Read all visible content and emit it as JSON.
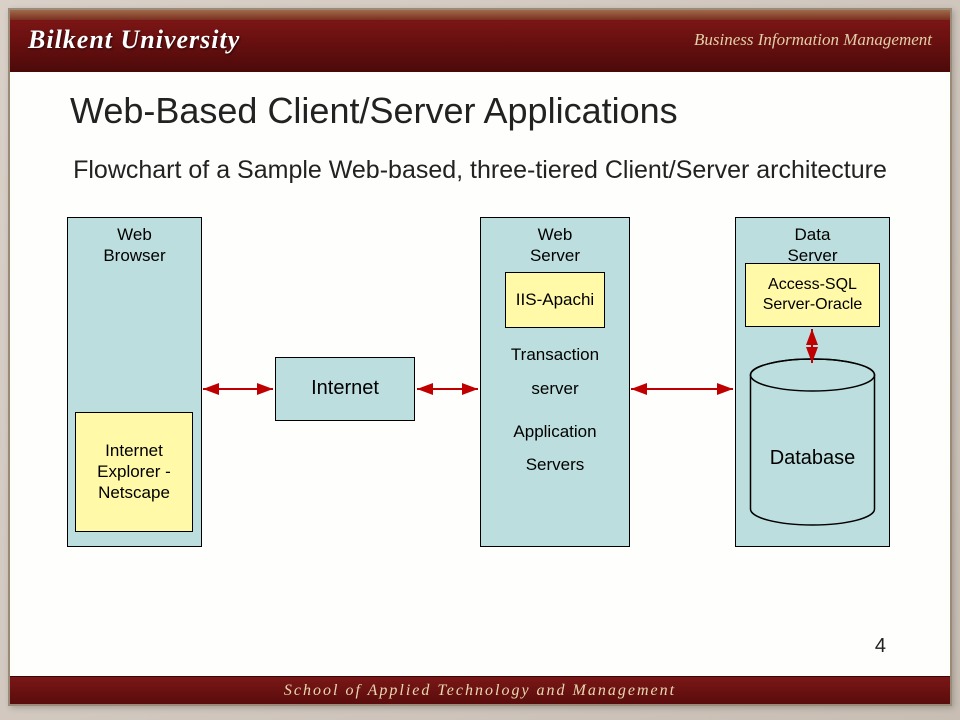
{
  "header": {
    "university": "Bilkent University",
    "department": "Business Information Management"
  },
  "footer": {
    "text": "School of Applied Technology and Management"
  },
  "slide": {
    "title": "Web-Based Client/Server Applications",
    "subtitle": "Flowchart of a Sample Web-based, three-tiered Client/Server architecture",
    "page_number": "4"
  },
  "diagram": {
    "browser_label": "Web\nBrowser",
    "internet_label": "Internet",
    "webserver_label": "Web\nServer",
    "dataserver_label": "Data\nServer",
    "ie_label": "Internet Explorer -Netscape",
    "iis_label": "IIS-Apachi",
    "access_label": "Access-SQL Server-Oracle",
    "trans1": "Transaction",
    "trans2": "server",
    "app1": "Application",
    "app2": "Servers",
    "db_label": "Database"
  }
}
